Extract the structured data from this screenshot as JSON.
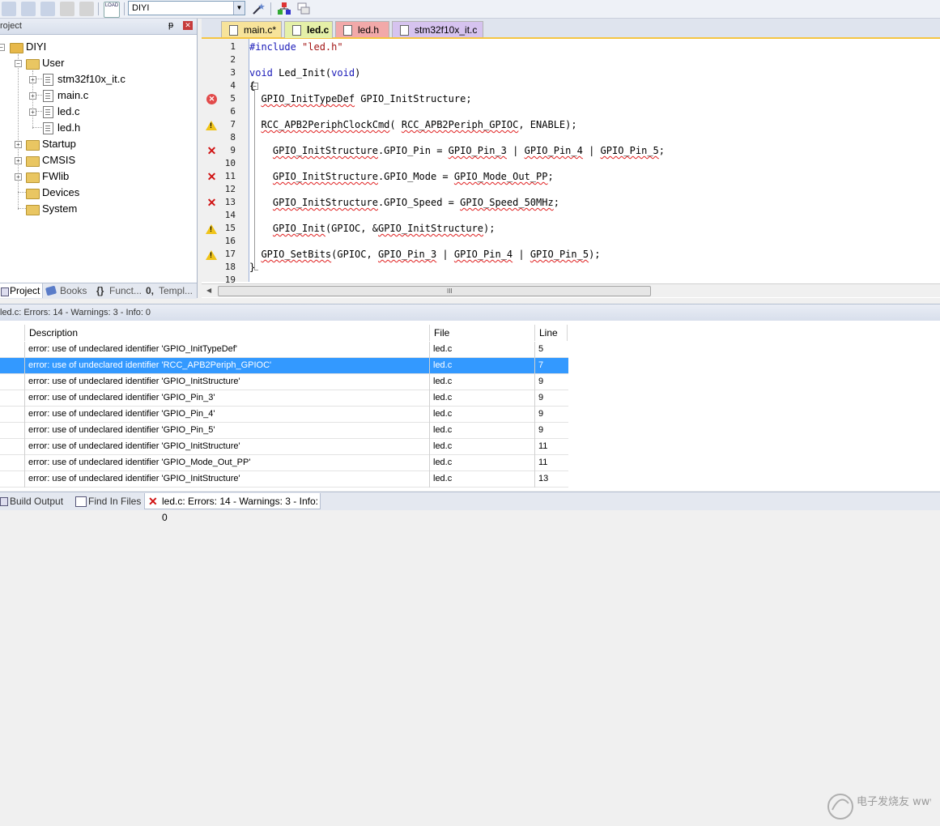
{
  "toolbar": {
    "target_value": "DIYI",
    "icons": [
      "stack-icon",
      "stack-icon",
      "stack-icon",
      "stack-icon",
      "stack-icon",
      "load-icon",
      "magic-wand-icon",
      "components-icon",
      "windows-icon"
    ],
    "load_label": "LOAD"
  },
  "project_panel": {
    "title": "roject",
    "tree": [
      {
        "label": "DIYI",
        "type": "root"
      },
      {
        "label": "User",
        "type": "folder"
      },
      {
        "label": "stm32f10x_it.c",
        "type": "file"
      },
      {
        "label": "main.c",
        "type": "file"
      },
      {
        "label": "led.c",
        "type": "file"
      },
      {
        "label": "led.h",
        "type": "file"
      },
      {
        "label": "Startup",
        "type": "folder"
      },
      {
        "label": "CMSIS",
        "type": "folder"
      },
      {
        "label": "FWlib",
        "type": "folder"
      },
      {
        "label": "Devices",
        "type": "folder"
      },
      {
        "label": "System",
        "type": "folder"
      }
    ],
    "tabs": [
      "Project",
      "Books",
      "Funct...",
      "Templ..."
    ]
  },
  "editor": {
    "tabs": [
      {
        "label": "main.c*",
        "color": "#f7e39a"
      },
      {
        "label": "led.c",
        "color": "#e5f0a8"
      },
      {
        "label": "led.h",
        "color": "#f2a9a9"
      },
      {
        "label": "stm32f10x_it.c",
        "color": "#d6c3ef"
      }
    ],
    "line_numbers": [
      "1",
      "2",
      "3",
      "4",
      "5",
      "6",
      "7",
      "8",
      "9",
      "10",
      "11",
      "12",
      "13",
      "14",
      "15",
      "16",
      "17",
      "18",
      "19"
    ],
    "code": {
      "l1_kw": "#include",
      "l1_str": "\"led.h\"",
      "l3_void": "void",
      "l3_name": " Led_Init(",
      "l3_arg": "void",
      "l3_end": ")",
      "l4": "{",
      "l5_a": "  ",
      "l5_type": "GPIO_InitTypeDef",
      "l5_b": " GPIO_InitStructure;",
      "l7_a": "  ",
      "l7_fn": "RCC_APB2PeriphClockCmd",
      "l7_b": "( ",
      "l7_c": "RCC_APB2Periph_GPIOC",
      "l7_d": ", ENABLE);",
      "l9_a": "    ",
      "l9_s": "GPIO_InitStructure",
      "l9_b": ".GPIO_Pin = ",
      "l9_p3": "GPIO_Pin_3",
      "l9_c": " | ",
      "l9_p4": "GPIO_Pin_4",
      "l9_d": " | ",
      "l9_p5": "GPIO_Pin_5",
      "l9_e": ";",
      "l11_a": "    ",
      "l11_s": "GPIO_InitStructure",
      "l11_b": ".GPIO_Mode = ",
      "l11_v": "GPIO_Mode_Out_PP",
      "l11_e": ";",
      "l13_a": "    ",
      "l13_s": "GPIO_InitStructure",
      "l13_b": ".GPIO_Speed = ",
      "l13_v": "GPIO_Speed_50MHz",
      "l13_e": ";",
      "l15_a": "    ",
      "l15_fn": "GPIO_Init",
      "l15_b": "(GPIOC, &",
      "l15_s": "GPIO_InitStructure",
      "l15_e": ");",
      "l17_a": "  ",
      "l17_fn": "GPIO_SetBits",
      "l17_b": "(GPIOC, ",
      "l17_p3": "GPIO_Pin_3",
      "l17_c": " | ",
      "l17_p4": "GPIO_Pin_4",
      "l17_d": " | ",
      "l17_p5": "GPIO_Pin_5",
      "l17_e": ");",
      "l18": "}"
    },
    "scroll_grip": "III"
  },
  "output": {
    "title": "led.c: Errors: 14 - Warnings: 3 - Info: 0",
    "columns": [
      "Description",
      "File",
      "Line"
    ],
    "rows": [
      {
        "desc": "error: use of undeclared identifier 'GPIO_InitTypeDef'",
        "file": "led.c",
        "line": "5"
      },
      {
        "desc": "error: use of undeclared identifier 'RCC_APB2Periph_GPIOC'",
        "file": "led.c",
        "line": "7"
      },
      {
        "desc": "error: use of undeclared identifier 'GPIO_InitStructure'",
        "file": "led.c",
        "line": "9"
      },
      {
        "desc": "error: use of undeclared identifier 'GPIO_Pin_3'",
        "file": "led.c",
        "line": "9"
      },
      {
        "desc": "error: use of undeclared identifier 'GPIO_Pin_4'",
        "file": "led.c",
        "line": "9"
      },
      {
        "desc": "error: use of undeclared identifier 'GPIO_Pin_5'",
        "file": "led.c",
        "line": "9"
      },
      {
        "desc": "error: use of undeclared identifier 'GPIO_InitStructure'",
        "file": "led.c",
        "line": "11"
      },
      {
        "desc": "error: use of undeclared identifier 'GPIO_Mode_Out_PP'",
        "file": "led.c",
        "line": "11"
      },
      {
        "desc": "error: use of undeclared identifier 'GPIO_InitStructure'",
        "file": "led.c",
        "line": "13"
      }
    ],
    "bottom_tabs": [
      "Build Output",
      "Find In Files",
      "led.c: Errors: 14 - Warnings: 3 - Info: 0"
    ]
  },
  "colors": {
    "selection": "#3399ff",
    "error": "#d01212",
    "warning": "#f0c419",
    "keyword": "#1a1ab8",
    "string": "#a31515"
  },
  "watermark_text": "电子发烧友 www.elecfans.com"
}
